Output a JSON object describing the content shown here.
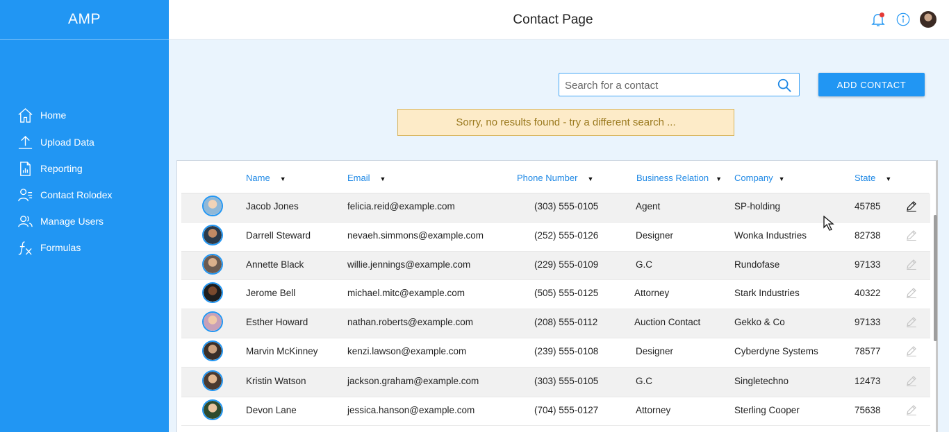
{
  "app": {
    "brand": "AMP"
  },
  "sidebar": {
    "items": [
      {
        "label": "Home",
        "icon": "home-icon"
      },
      {
        "label": "Upload Data",
        "icon": "upload-icon"
      },
      {
        "label": "Reporting",
        "icon": "report-icon"
      },
      {
        "label": "Contact Rolodex",
        "icon": "contacts-icon"
      },
      {
        "label": "Manage Users",
        "icon": "users-icon"
      },
      {
        "label": "Formulas",
        "icon": "function-icon"
      }
    ]
  },
  "header": {
    "title": "Contact Page"
  },
  "search": {
    "placeholder": "Search for a contact",
    "value": ""
  },
  "add_button": {
    "label": "ADD CONTACT"
  },
  "alert": {
    "message": "Sorry, no results found - try a different search ..."
  },
  "table": {
    "columns": [
      "Name",
      "Email",
      "Phone Number",
      "Business Relation",
      "Company",
      "State"
    ],
    "rows": [
      {
        "name": "Jacob Jones",
        "email": "felicia.reid@example.com",
        "phone": "(303) 555-0105",
        "relation": "Agent",
        "company": "SP-holding",
        "state": "45785"
      },
      {
        "name": "Darrell Steward",
        "email": "nevaeh.simmons@example.com",
        "phone": "(252) 555-0126",
        "relation": "Designer",
        "company": "Wonka Industries",
        "state": "82738"
      },
      {
        "name": "Annette Black",
        "email": "willie.jennings@example.com",
        "phone": "(229) 555-0109",
        "relation": "G.C",
        "company": "Rundofase",
        "state": "97133"
      },
      {
        "name": "Jerome Bell",
        "email": "michael.mitc@example.com",
        "phone": "(505) 555-0125",
        "relation": "Attorney",
        "company": "Stark Industries",
        "state": "40322"
      },
      {
        "name": "Esther Howard",
        "email": "nathan.roberts@example.com",
        "phone": "(208) 555-0112",
        "relation": "Auction Contact",
        "company": "Gekko & Co",
        "state": "97133"
      },
      {
        "name": "Marvin McKinney",
        "email": "kenzi.lawson@example.com",
        "phone": "(239) 555-0108",
        "relation": "Designer",
        "company": "Cyberdyne Systems",
        "state": "78577"
      },
      {
        "name": "Kristin Watson",
        "email": "jackson.graham@example.com",
        "phone": "(303) 555-0105",
        "relation": "G.C",
        "company": "Singletechno",
        "state": "12473"
      },
      {
        "name": "Devon Lane",
        "email": "jessica.hanson@example.com",
        "phone": "(704) 555-0127",
        "relation": "Attorney",
        "company": "Sterling Cooper",
        "state": "75638"
      }
    ]
  },
  "colors": {
    "accent": "#2196f3",
    "alert_bg": "#fdebc8",
    "alert_text": "#9b7a1f"
  }
}
